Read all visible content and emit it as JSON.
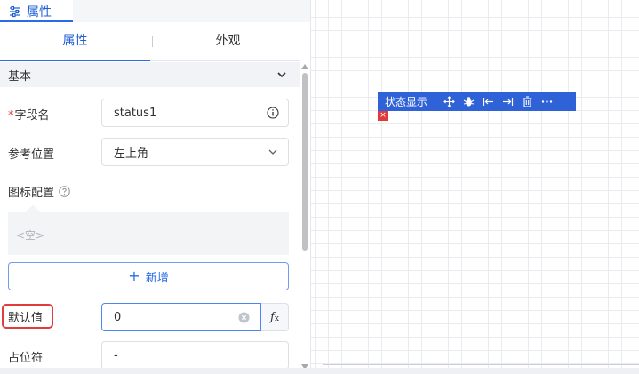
{
  "panel": {
    "top_tab_label": "属性",
    "tabs": [
      {
        "label": "属性",
        "active": true
      },
      {
        "label": "外观",
        "active": false
      }
    ],
    "section_title": "基本",
    "fields": {
      "field_name": {
        "label": "字段名",
        "required_mark": "*",
        "value": "status1"
      },
      "ref_position": {
        "label": "参考位置",
        "value": "左上角"
      },
      "icon_config": {
        "label": "图标配置",
        "empty_text": "<空>"
      },
      "add_button_label": "新增",
      "default_value": {
        "label": "默认值",
        "value": "0"
      },
      "placeholder": {
        "label": "占位符",
        "value": "-"
      }
    }
  },
  "canvas": {
    "toolbar_title": "状态显示",
    "toolbar_icons": [
      "move-icon",
      "bug-icon",
      "align-left-icon",
      "align-right-icon",
      "trash-icon",
      "more-icon"
    ],
    "badge": "×"
  },
  "colors": {
    "accent": "#2a6ce8",
    "toolbar_bg": "#2f62d6",
    "highlight": "#e23b3b"
  }
}
